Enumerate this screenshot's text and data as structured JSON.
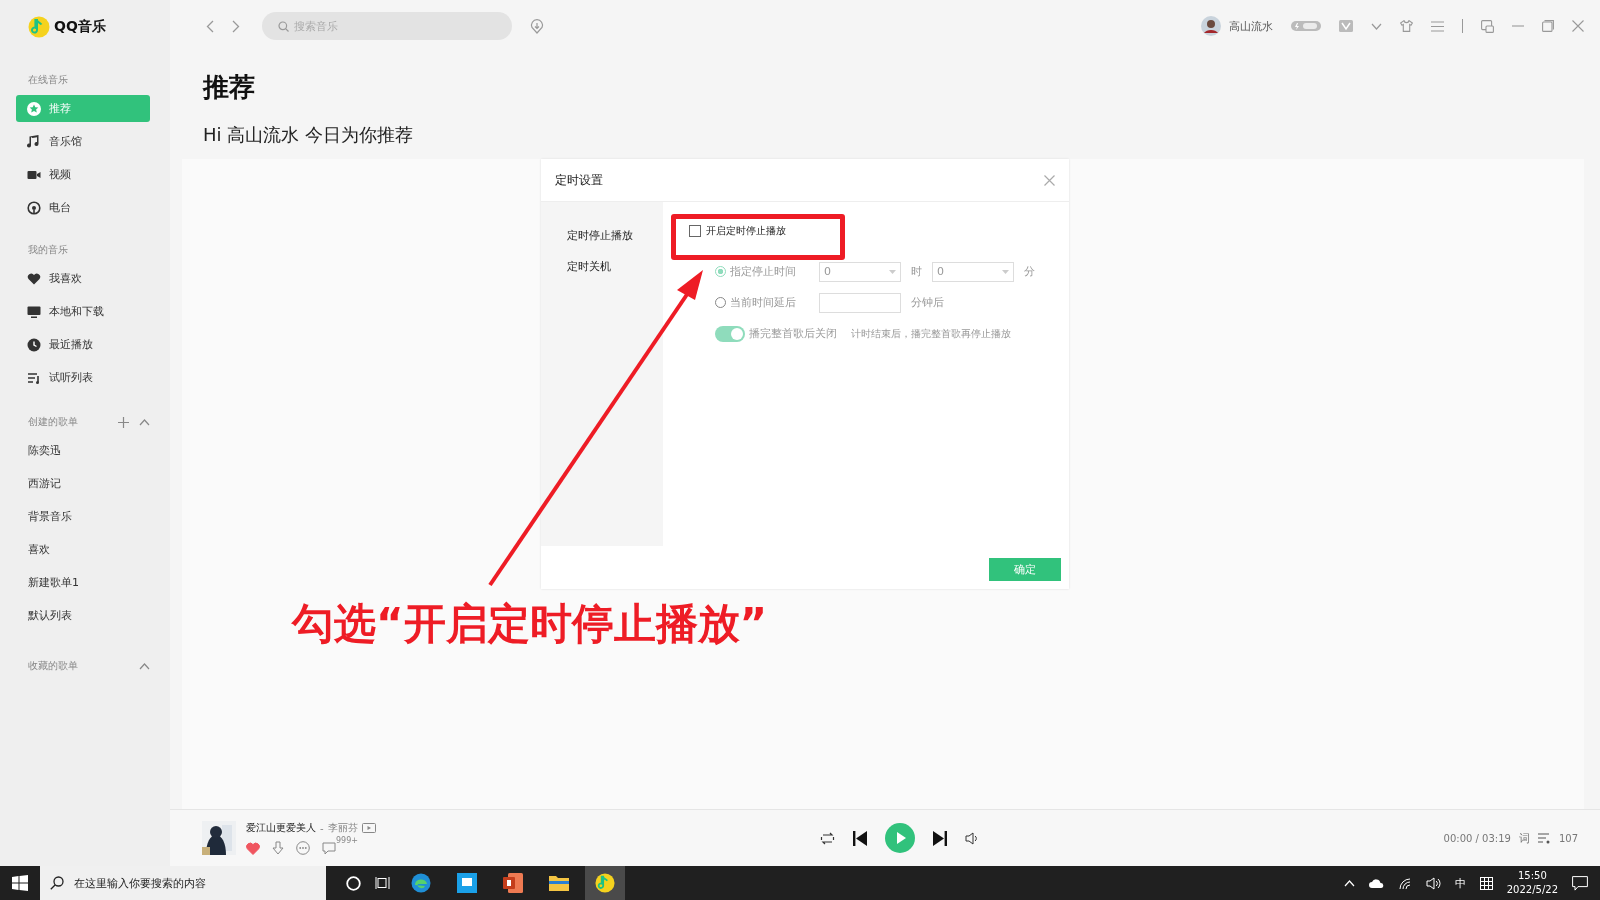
{
  "app": {
    "name": "QQ音乐"
  },
  "sidebar": {
    "sections": [
      {
        "title": "在线音乐",
        "items": [
          {
            "label": "推荐",
            "selected": true
          },
          {
            "label": "音乐馆",
            "selected": false
          },
          {
            "label": "视频",
            "selected": false
          },
          {
            "label": "电台",
            "selected": false
          }
        ]
      },
      {
        "title": "我的音乐",
        "items": [
          {
            "label": "我喜欢",
            "selected": false
          },
          {
            "label": "本地和下载",
            "selected": false
          },
          {
            "label": "最近播放",
            "selected": false
          },
          {
            "label": "试听列表",
            "selected": false
          }
        ]
      }
    ],
    "created_playlists": {
      "title": "创建的歌单",
      "expanded": true,
      "items": [
        "陈奕迅",
        "西游记",
        "背景音乐",
        "喜欢",
        "新建歌单1",
        "默认列表"
      ]
    },
    "collected_playlists": {
      "title": "收藏的歌单",
      "expanded": true
    }
  },
  "topbar": {
    "search": {
      "placeholder": "搜索音乐"
    },
    "user": {
      "name": "高山流水"
    }
  },
  "page": {
    "title": "推荐",
    "greeting": "Hi 高山流水 今日为你推荐"
  },
  "dialog": {
    "title": "定时设置",
    "nav": [
      "定时停止播放",
      "定时关机"
    ],
    "disabled": true,
    "enable": {
      "label": "开启定时停止播放",
      "checked": false
    },
    "modes": [
      {
        "kind": "time",
        "label": "指定停止时间",
        "selected": true,
        "hour": "0",
        "hour_unit": "时",
        "minute": "0",
        "minute_unit": "分"
      },
      {
        "kind": "delay",
        "label": "当前时间延后",
        "selected": false,
        "unit": "分钟后"
      }
    ],
    "finish_song": {
      "label": "播完整首歌后关闭",
      "on": true,
      "hint": "计时结束后，播完整首歌再停止播放"
    },
    "confirm": "确定"
  },
  "annotation": {
    "text": "勾选“开启定时停止播放”"
  },
  "player": {
    "song": "爱江山更爱美人",
    "separator": "-",
    "artist": "李丽芬",
    "liked": true,
    "comments": "999+",
    "time": "00:00 / 03:19",
    "lyrics": "词",
    "queue_count": "107"
  },
  "taskbar": {
    "search": {
      "placeholder": "在这里输入你要搜索的内容"
    },
    "ime": "中",
    "time": "15:50",
    "date": "2022/5/22"
  }
}
